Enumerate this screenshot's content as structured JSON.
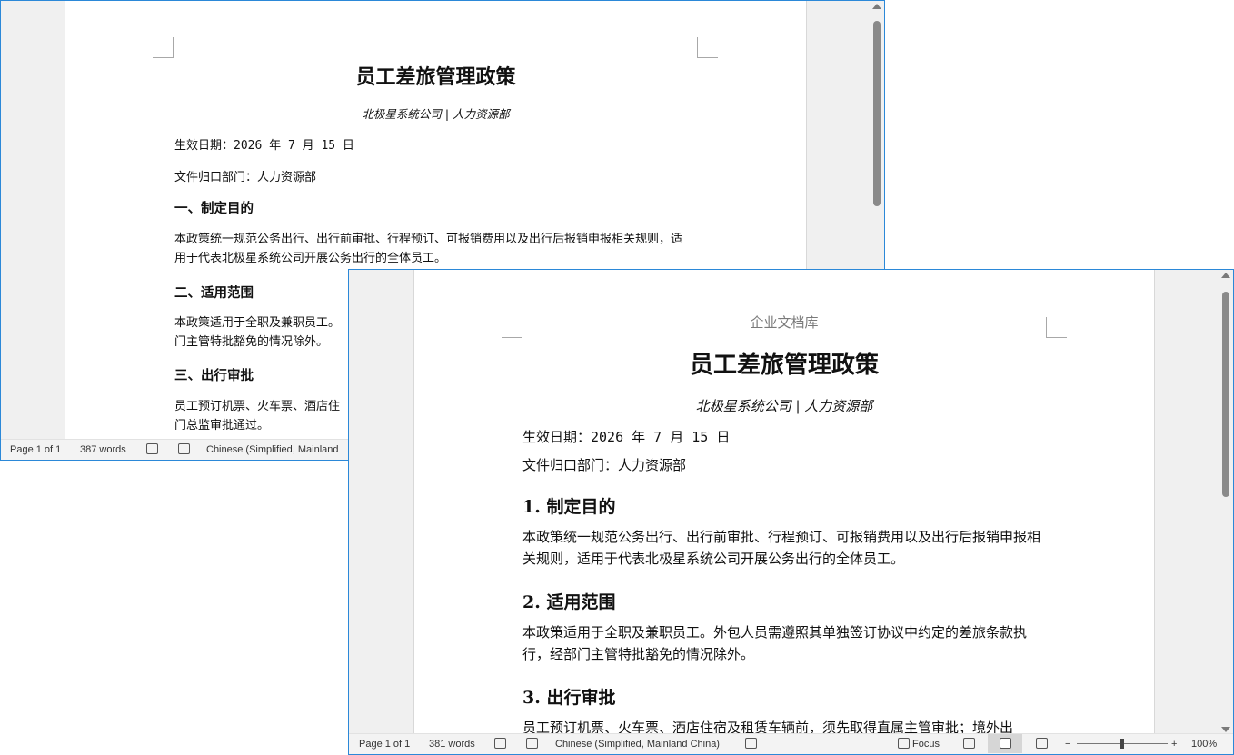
{
  "back_window": {
    "doc": {
      "title": "员工差旅管理政策",
      "subtitle": "北极星系统公司 | 人力资源部",
      "effective_date": "生效日期：2026 年 7 月 15 日",
      "owner_dept": "文件归口部门：人力资源部",
      "sections": [
        {
          "heading": "一、制定目的",
          "body": "本政策统一规范公务出行、出行前审批、行程预订、可报销费用以及出行后报销申报相关规则，适用于代表北极星系统公司开展公务出行的全体员工。"
        },
        {
          "heading": "二、适用范围",
          "body": "本政策适用于全职及兼职员工。",
          "body2": "门主管特批豁免的情况除外。"
        },
        {
          "heading": "三、出行审批",
          "body": "员工预订机票、火车票、酒店住",
          "body2": "门总监审批通过。"
        }
      ]
    },
    "status": {
      "page": "Page 1 of 1",
      "words": "387 words",
      "language": "Chinese (Simplified, Mainland"
    }
  },
  "front_window": {
    "doc": {
      "header": "企业文档库",
      "title": "员工差旅管理政策",
      "subtitle": "北极星系统公司 | 人力资源部",
      "effective_date": "生效日期：2026 年 7 月 15 日",
      "owner_dept": "文件归口部门：人力资源部",
      "sections": [
        {
          "heading": "1. 制定目的",
          "body": "本政策统一规范公务出行、出行前审批、行程预订、可报销费用以及出行后报销申报相关规则，适用于代表北极星系统公司开展公务出行的全体员工。"
        },
        {
          "heading": "2. 适用范围",
          "body": "本政策适用于全职及兼职员工。外包人员需遵照其单独签订协议中约定的差旅条款执行，经部门主管特批豁免的情况除外。"
        },
        {
          "heading": "3. 出行审批",
          "body": "员工预订机票、火车票、酒店住宿及租赁车辆前，须先取得直属主管审批；境外出"
        }
      ]
    },
    "status": {
      "page": "Page 1 of 1",
      "words": "381 words",
      "language": "Chinese (Simplified, Mainland China)",
      "focus": "Focus",
      "zoom": "100%",
      "zoom_minus": "−",
      "zoom_plus": "+"
    }
  }
}
